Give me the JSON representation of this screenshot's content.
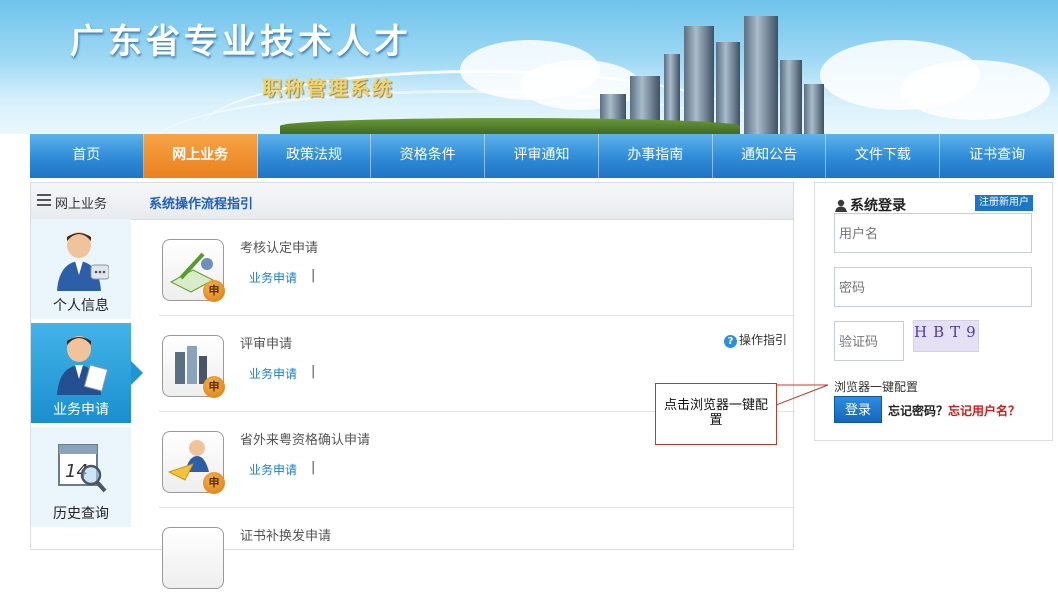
{
  "banner": {
    "title": "广东省专业技术人才",
    "subtitle": "职称管理系统"
  },
  "nav": {
    "items": [
      {
        "label": "首页",
        "active": false
      },
      {
        "label": "网上业务",
        "active": true
      },
      {
        "label": "政策法规",
        "active": false
      },
      {
        "label": "资格条件",
        "active": false
      },
      {
        "label": "评审通知",
        "active": false
      },
      {
        "label": "办事指南",
        "active": false
      },
      {
        "label": "通知公告",
        "active": false
      },
      {
        "label": "文件下载",
        "active": false
      },
      {
        "label": "证书查询",
        "active": false
      }
    ]
  },
  "main": {
    "header_label": "网上业务",
    "header_link": "系统操作流程指引",
    "side_menu": [
      {
        "label": "个人信息",
        "icon": "person-info-icon",
        "active": false
      },
      {
        "label": "业务申请",
        "icon": "person-apply-icon",
        "active": true
      },
      {
        "label": "历史查询",
        "icon": "calendar-search-icon",
        "active": false
      }
    ],
    "rows": [
      {
        "title": "考核认定申请",
        "link": "业务申请",
        "separator": "|",
        "icon": "certify-application-icon"
      },
      {
        "title": "评审申请",
        "link": "业务申请",
        "separator": "|",
        "icon": "review-application-icon",
        "guide": "操作指引"
      },
      {
        "title": "省外来粤资格确认申请",
        "link": "业务申请",
        "separator": "|",
        "icon": "paper-plane-application-icon"
      },
      {
        "title": "证书补换发申请",
        "link": "",
        "separator": "",
        "icon": "certificate-reissue-icon"
      }
    ]
  },
  "login": {
    "title": "系统登录",
    "register": "注册新用户",
    "username_placeholder": "用户名",
    "password_placeholder": "密码",
    "captcha_placeholder": "验证码",
    "captcha_text": "HBT9",
    "browser_config": "浏览器一键配置",
    "login_button": "登录",
    "forgot_password": "忘记密码？",
    "forgot_username": "忘记用户名？"
  },
  "callout": {
    "text": "点击浏览器一键配置"
  },
  "colors": {
    "nav_blue": "#2f8ad8",
    "nav_active": "#e9801d",
    "link_blue": "#1e7fc8",
    "forgot_red": "#d11b1b"
  }
}
